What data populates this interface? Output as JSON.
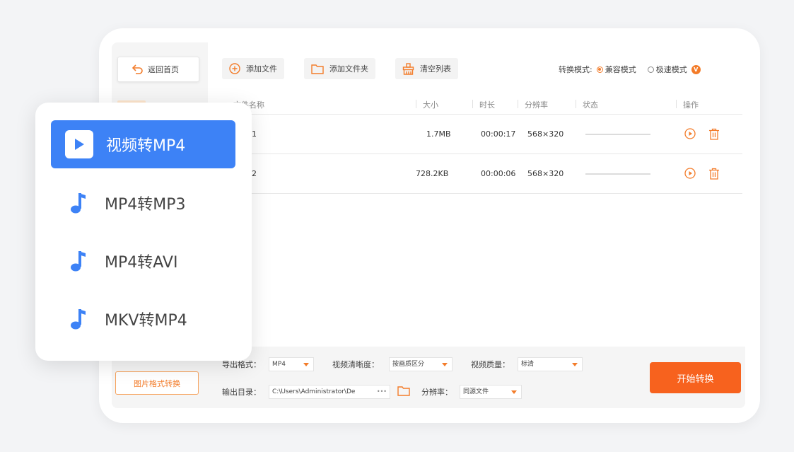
{
  "sidebar": {
    "back_label": "返回首页",
    "image_convert_label": "图片格式转换"
  },
  "toolbar": {
    "add_file": "添加文件",
    "add_folder": "添加文件夹",
    "clear_list": "清空列表",
    "mode_label": "转换模式:",
    "mode_compat": "兼容模式",
    "mode_fast": "极速模式",
    "vip_badge": "V"
  },
  "table": {
    "headers": [
      "文件名称",
      "大小",
      "时长",
      "分辨率",
      "状态",
      "操作"
    ],
    "rows": [
      {
        "name": "1",
        "size": "1.7MB",
        "duration": "00:00:17",
        "resolution": "568×320"
      },
      {
        "name": "2",
        "size": "728.2KB",
        "duration": "00:00:06",
        "resolution": "568×320"
      }
    ]
  },
  "bottom": {
    "format_label": "导出格式：",
    "format_value": "MP4",
    "clarity_label": "视频清晰度：",
    "clarity_value": "按画质区分",
    "quality_label": "视频质量：",
    "quality_value": "标清",
    "outdir_label": "输出目录：",
    "outdir_value": "C:\\Users\\Administrator\\De",
    "outdir_more": "•••",
    "resolution_label": "分辨率：",
    "resolution_value": "同源文件",
    "start_label": "开始转换"
  },
  "popup": {
    "items": [
      "视频转MP4",
      "MP4转MP3",
      "MP4转AVI",
      "MKV转MP4"
    ]
  },
  "colors": {
    "accent_orange": "#f7621e",
    "accent_blue": "#3d82f6"
  }
}
